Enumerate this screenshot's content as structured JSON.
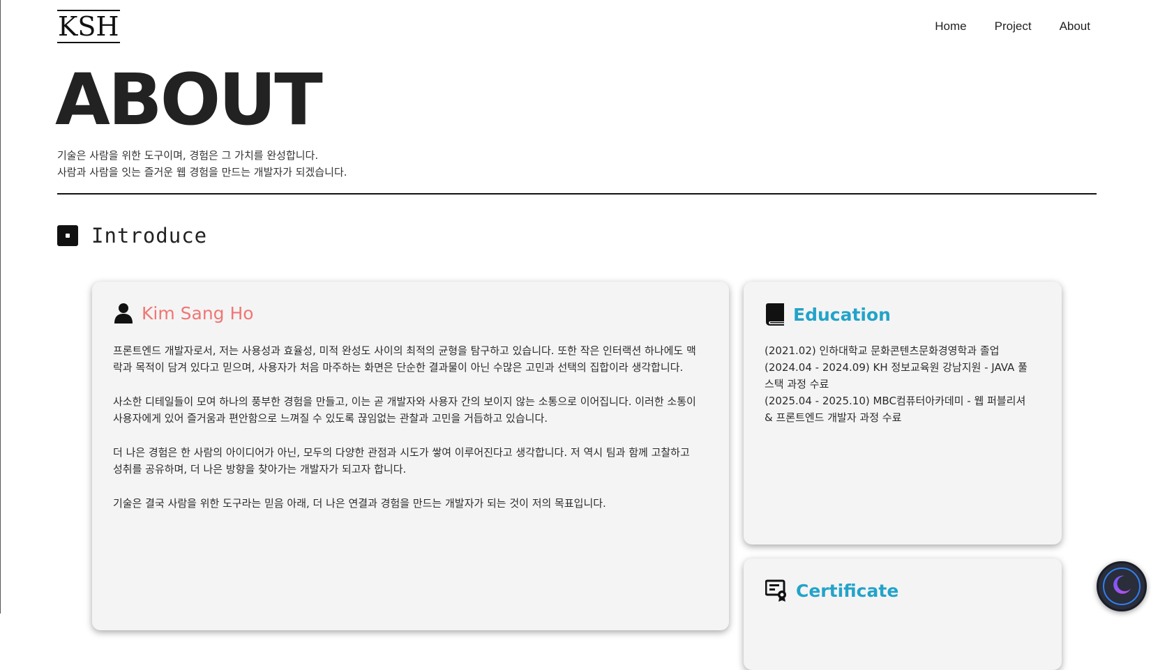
{
  "header": {
    "logo": "KSH",
    "nav": [
      "Home",
      "Project",
      "About"
    ]
  },
  "hero": {
    "title": "ABOUT",
    "subtitle_lines": [
      "기술은 사람을 위한 도구이며, 경험은 그 가치를 완성합니다.",
      "사람과 사람을 잇는 즐거운 웹 경험을 만드는 개발자가 되겠습니다."
    ]
  },
  "section": {
    "title": "Introduce"
  },
  "profile": {
    "name": "Kim Sang Ho",
    "icon": "user-icon",
    "paragraphs": [
      "프론트엔드 개발자로서, 저는 사용성과 효율성, 미적 완성도 사이의 최적의 균형을 탐구하고 있습니다. 또한 작은 인터랙션 하나에도 맥락과 목적이 담겨 있다고 믿으며, 사용자가 처음 마주하는 화면은 단순한 결과물이 아닌 수많은 고민과 선택의 집합이라 생각합니다.",
      "사소한 디테일들이 모여 하나의 풍부한 경험을 만들고, 이는 곧 개발자와 사용자 간의 보이지 않는 소통으로 이어집니다. 이러한 소통이 사용자에게 있어 즐거움과 편안함으로 느껴질 수 있도록 끊임없는 관찰과 고민을 거듭하고 있습니다.",
      "더 나은 경험은 한 사람의 아이디어가 아닌, 모두의 다양한 관점과 시도가 쌓여 이루어진다고 생각합니다. 저 역시 팀과 함께 고찰하고 성취를 공유하며, 더 나은 방향을 찾아가는 개발자가 되고자 합니다.",
      "기술은 결국 사람을 위한 도구라는 믿음 아래, 더 나은 연결과 경험을 만드는 개발자가 되는 것이 저의 목표입니다."
    ]
  },
  "education": {
    "title": "Education",
    "icon": "book-icon",
    "items": [
      "(2021.02) 인하대학교 문화콘텐츠문화경영학과 졸업",
      "(2024.04 - 2024.09) KH 정보교육원 강남지원 - JAVA 풀스택 과정 수료",
      "(2025.04 - 2025.10) MBC컴퓨터아카데미 - 웹 퍼블리셔 & 프론트엔드 개발자 과정 수료"
    ]
  },
  "certificate": {
    "title": "Certificate",
    "icon": "certificate-icon"
  },
  "theme_toggle": {
    "icon": "moon-icon"
  },
  "colors": {
    "profile_accent": "#f07674",
    "section_accent": "#23a3c9",
    "card_bg": "#f4f4f4",
    "text": "#222222"
  }
}
